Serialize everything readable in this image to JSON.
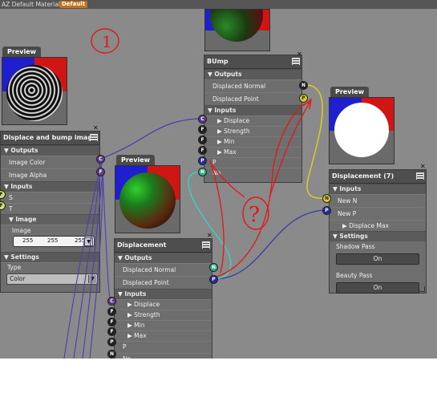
{
  "titlebar": {
    "title": "AZ Default Material",
    "badge": "Default"
  },
  "preview_top": {},
  "preview_left": {
    "tab": "Preview"
  },
  "preview_mid": {
    "tab": "Preview"
  },
  "preview_right": {
    "tab": "Preview"
  },
  "bump": {
    "title": "BUmp",
    "outputs_label": "Outputs",
    "outputs": [
      {
        "label": "Displaced Normal",
        "sock": "N"
      },
      {
        "label": "Displaced Point",
        "sock": "P"
      }
    ],
    "inputs_label": "Inputs",
    "inputs": [
      {
        "label": "Displace",
        "sock": "C"
      },
      {
        "label": "Strength",
        "sock": "F"
      },
      {
        "label": "Min",
        "sock": "F"
      },
      {
        "label": "Max",
        "sock": "F"
      },
      {
        "label": "P",
        "sock": "P"
      },
      {
        "label": "Nn",
        "sock": "N"
      }
    ]
  },
  "dbi": {
    "title": "Displace and bump image",
    "outputs_label": "Outputs",
    "outputs": [
      {
        "label": "Image Color",
        "sock": "C"
      },
      {
        "label": "Image Alpha",
        "sock": "F"
      }
    ],
    "inputs_label": "Inputs",
    "inputs": [
      {
        "label": "S",
        "sock": "F"
      },
      {
        "label": "T",
        "sock": "F"
      }
    ],
    "image_group": "Image",
    "image_label": "Image",
    "rgb": [
      "255",
      "255",
      "255"
    ],
    "settings_label": "Settings",
    "type_label": "Type",
    "type_value": "Color"
  },
  "disp": {
    "title": "Displacement",
    "outputs_label": "Outputs",
    "outputs": [
      {
        "label": "Displaced Normal",
        "sock": "N"
      },
      {
        "label": "Displaced Point",
        "sock": "P"
      }
    ],
    "inputs_label": "Inputs",
    "inputs": [
      {
        "label": "Displace",
        "sock": "C"
      },
      {
        "label": "Strength",
        "sock": "F"
      },
      {
        "label": "Min",
        "sock": "F"
      },
      {
        "label": "Max",
        "sock": "F"
      },
      {
        "label": "P",
        "sock": "P"
      },
      {
        "label": "Nn",
        "sock": "N"
      }
    ]
  },
  "disp7": {
    "title": "Displacement (7)",
    "inputs_label": "Inputs",
    "inputs": [
      {
        "label": "New N",
        "sock": "N"
      },
      {
        "label": "New P",
        "sock": "P"
      }
    ],
    "displace_max": "Displace Max",
    "settings_label": "Settings",
    "shadow_label": "Shadow Pass",
    "shadow_value": "On",
    "beauty_label": "Beauty Pass",
    "beauty_value": "On"
  },
  "annotations": {
    "one": "1",
    "question": "?"
  },
  "colors": {
    "wire_purple": "#4a3fb0",
    "wire_yellow": "#d8cc2c",
    "wire_cyan": "#36d4c8",
    "wire_red": "#e01818",
    "badge": "#c8711c"
  }
}
